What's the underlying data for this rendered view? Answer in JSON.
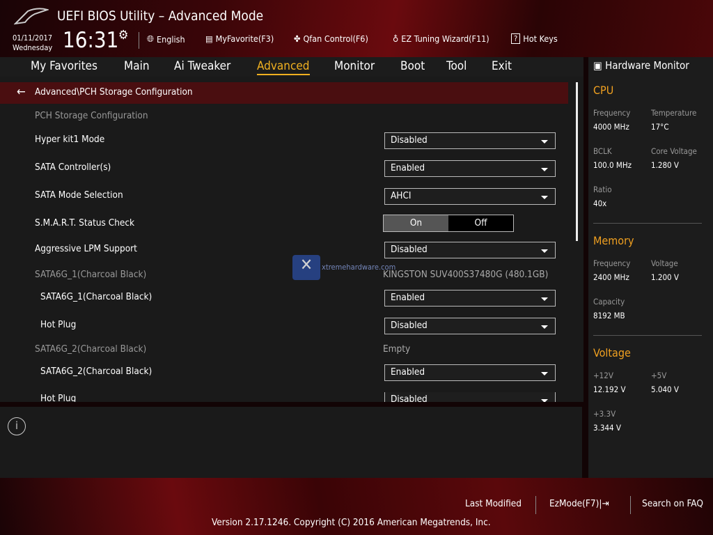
{
  "header": {
    "title": "UEFI BIOS Utility – Advanced Mode",
    "date": "01/11/2017",
    "day": "Wednesday",
    "time": "16:31",
    "tools": [
      {
        "icon": "globe-icon",
        "label": "English"
      },
      {
        "icon": "favorite-list-icon",
        "label": "MyFavorite(F3)"
      },
      {
        "icon": "fan-icon",
        "label": "Qfan Control(F6)"
      },
      {
        "icon": "lightbulb-icon",
        "label": "EZ Tuning Wizard(F11)"
      },
      {
        "icon": "help-icon",
        "label": "Hot Keys"
      }
    ]
  },
  "nav": {
    "tabs": [
      "My Favorites",
      "Main",
      "Ai Tweaker",
      "Advanced",
      "Monitor",
      "Boot",
      "Tool",
      "Exit"
    ],
    "active": "Advanced"
  },
  "breadcrumb": "Advanced\\PCH Storage Configuration",
  "settings": {
    "section": "PCH Storage Configuration",
    "hyper_kit": {
      "label": "Hyper kit1 Mode",
      "value": "Disabled"
    },
    "sata_ctrl": {
      "label": "SATA Controller(s)",
      "value": "Enabled"
    },
    "sata_mode": {
      "label": "SATA Mode Selection",
      "value": "AHCI"
    },
    "smart": {
      "label": "S.M.A.R.T. Status Check",
      "on": "On",
      "off": "Off",
      "selected": "On"
    },
    "lpm": {
      "label": "Aggressive LPM Support",
      "value": "Disabled"
    },
    "port1": {
      "label": "SATA6G_1(Charcoal Black)",
      "device": "KINGSTON SUV400S37480G (480.1GB)"
    },
    "port1_en": {
      "label": "SATA6G_1(Charcoal Black)",
      "value": "Enabled"
    },
    "port1_hp": {
      "label": "Hot Plug",
      "value": "Disabled"
    },
    "port2": {
      "label": "SATA6G_2(Charcoal Black)",
      "device": "Empty"
    },
    "port2_en": {
      "label": "SATA6G_2(Charcoal Black)",
      "value": "Enabled"
    },
    "port2_hp": {
      "label": "Hot Plug",
      "value": "Disabled"
    }
  },
  "watermark": "xtremehardware.com",
  "monitor": {
    "title": "Hardware Monitor",
    "cpu": {
      "heading": "CPU",
      "freq_l": "Frequency",
      "freq": "4000 MHz",
      "temp_l": "Temperature",
      "temp": "17°C",
      "bclk_l": "BCLK",
      "bclk": "100.0 MHz",
      "cv_l": "Core Voltage",
      "cv": "1.280 V",
      "ratio_l": "Ratio",
      "ratio": "40x"
    },
    "memory": {
      "heading": "Memory",
      "freq_l": "Frequency",
      "freq": "2400 MHz",
      "volt_l": "Voltage",
      "volt": "1.200 V",
      "cap_l": "Capacity",
      "cap": "8192 MB"
    },
    "voltage": {
      "heading": "Voltage",
      "v12_l": "+12V",
      "v12": "12.192 V",
      "v5_l": "+5V",
      "v5": "5.040 V",
      "v33_l": "+3.3V",
      "v33": "3.344 V"
    }
  },
  "footer": {
    "last_modified": "Last Modified",
    "ezmode": "EzMode(F7)|",
    "search": "Search on FAQ",
    "version": "Version 2.17.1246. Copyright (C) 2016 American Megatrends, Inc."
  },
  "colors": {
    "accent": "#f0b020",
    "breadcrumb_bg": "#4a0e10"
  }
}
